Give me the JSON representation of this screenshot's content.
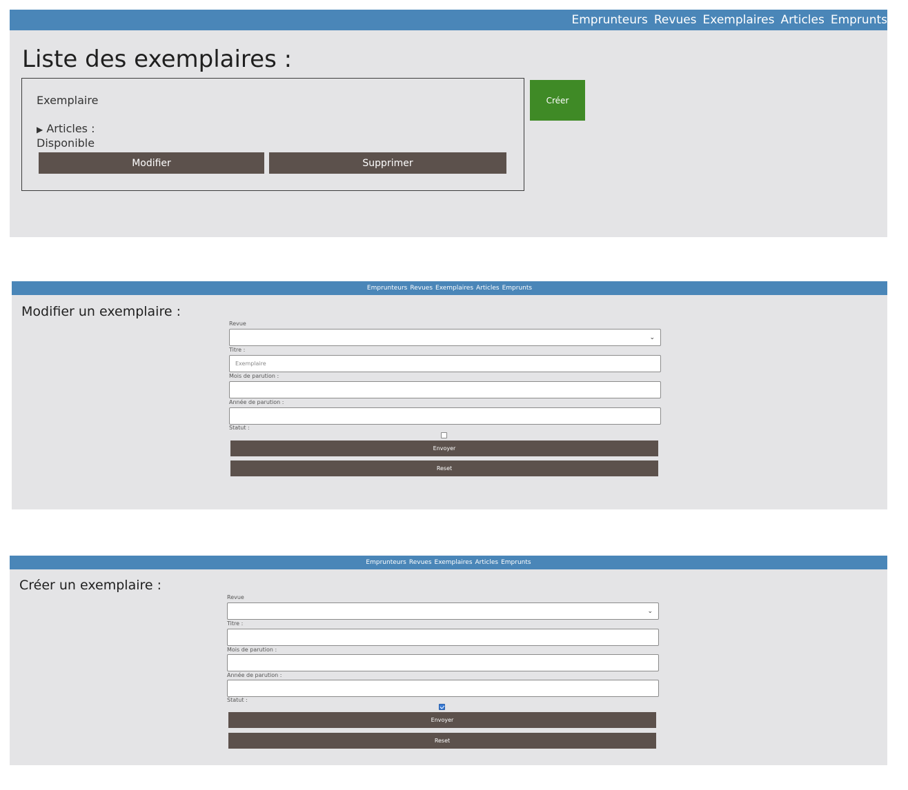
{
  "nav": {
    "links": [
      "Emprunteurs",
      "Revues",
      "Exemplaires",
      "Articles",
      "Emprunts"
    ]
  },
  "list_page": {
    "title": "Liste des exemplaires :",
    "create_label": "Créer",
    "item": {
      "title": "Exemplaire",
      "articles_label": "Articles :",
      "status": "Disponible",
      "modify_label": "Modifier",
      "delete_label": "Supprimer"
    }
  },
  "edit_page": {
    "title": "Modifier un exemplaire :",
    "revue_label": "Revue",
    "titre_label": "Titre :",
    "titre_value": "Exemplaire",
    "mois_label": "Mois de parution :",
    "annee_label": "Année de parution :",
    "statut_label": "Statut :",
    "statut_checked": false,
    "send_label": "Envoyer",
    "reset_label": "Reset"
  },
  "create_page": {
    "title": "Créer un exemplaire :",
    "revue_label": "Revue",
    "titre_label": "Titre :",
    "mois_label": "Mois de parution :",
    "annee_label": "Année de parution :",
    "statut_label": "Statut :",
    "statut_checked": true,
    "send_label": "Envoyer",
    "reset_label": "Reset"
  },
  "colors": {
    "navbar": "#4a86b8",
    "panel_bg": "#e4e4e6",
    "button_dark": "#5c514c",
    "button_create": "#3f8a26"
  }
}
